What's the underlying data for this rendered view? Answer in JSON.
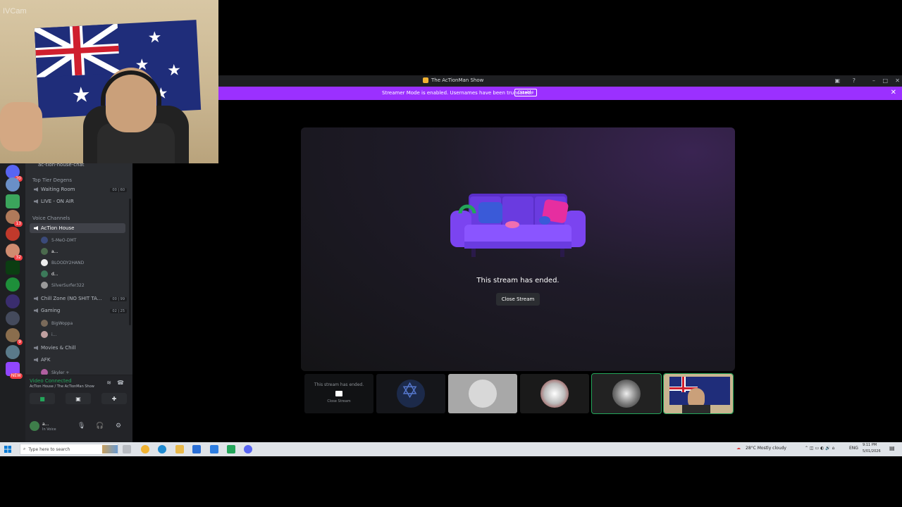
{
  "webcam": {
    "brand": "IVCam"
  },
  "discord": {
    "window_title": "The AcTionMan Show",
    "streamer_banner": {
      "message": "Streamer Mode is enabled. Usernames have been truncated.",
      "button": "Disable"
    },
    "channels": {
      "top_channel": "ac-tion-house-chat",
      "category_top": "Top Tier Degens",
      "waiting_room": "Waiting Room",
      "waiting_room_count": "00 | 60",
      "live_on_air": "LIVE - ON AIR",
      "category_voice": "Voice Channels",
      "action_house": "AcTion House",
      "action_house_members": [
        "5-MeO-DMT",
        "a...",
        "BLOODY2HAND",
        "d...",
        "SilverSurfer322"
      ],
      "chill_zone": "Chill Zone (NO SHIT TA...",
      "chill_zone_count": "00 | 99",
      "gaming": "Gaming",
      "gaming_count": "02 | 25",
      "gaming_members": [
        "BigWoppa",
        "i..."
      ],
      "movies": "Movies & Chill",
      "afk": "AFK",
      "afk_members": [
        "Skyler +"
      ]
    },
    "voice_status": {
      "title": "Video Connected",
      "subtitle": "AcTion House / The AcTionMan Show"
    },
    "user": {
      "name": "a...",
      "status": "In Voice"
    },
    "stream": {
      "ended_text": "This stream has ended.",
      "close_button": "Close Stream",
      "thumb_ended_text": "This stream has ended.",
      "thumb_close_text": "Close Stream"
    }
  },
  "taskbar": {
    "search_placeholder": "Type here to search",
    "weather": "28°C  Mostly cloudy",
    "language": "ENG",
    "time": "9:11 PM",
    "date": "5/01/2026"
  },
  "colors": {
    "streamer_purple": "#9b30ff",
    "discord_dark": "#2b2d31",
    "connected_green": "#23a55a"
  }
}
